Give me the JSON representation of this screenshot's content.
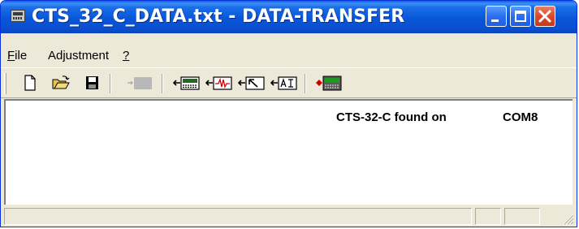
{
  "window": {
    "title": "CTS_32_C_DATA.txt - DATA-TRANSFER",
    "titlebar_color": "#0a5fdc",
    "close_color": "#d9492a"
  },
  "menu": {
    "items": [
      {
        "mnemonic": "F",
        "rest": "ile"
      },
      {
        "mnemonic": "",
        "rest": "Adjustment"
      },
      {
        "mnemonic": "?",
        "rest": ""
      }
    ]
  },
  "toolbar": {
    "icons": [
      "new-file-icon",
      "open-folder-icon",
      "save-disk-icon",
      "transfer-disabled-icon",
      "read-display-icon",
      "read-signal-icon",
      "read-cursor-icon",
      "read-ai-icon",
      "send-device-icon"
    ]
  },
  "status": {
    "device": "CTS-32-C found on",
    "port": "COM8"
  }
}
